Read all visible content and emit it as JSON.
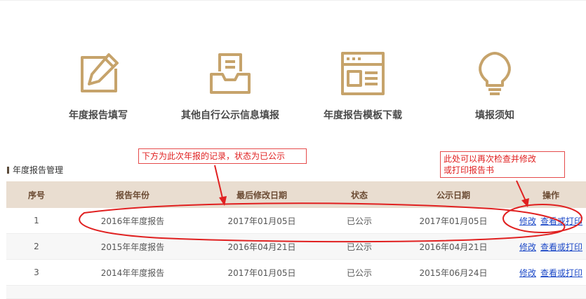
{
  "colors": {
    "gold": "#c6a36b",
    "annotation_red": "#e02020",
    "header_bg": "#e9ddd0"
  },
  "nav": [
    {
      "label": "年度报告填写",
      "icon": "edit-pencil-icon"
    },
    {
      "label": "其他自行公示信息填报",
      "icon": "inbox-tray-icon"
    },
    {
      "label": "年度报告模板下载",
      "icon": "template-window-icon"
    },
    {
      "label": "填报须知",
      "icon": "lightbulb-icon"
    }
  ],
  "section": {
    "title": "年度报告管理"
  },
  "table": {
    "headers": [
      "序号",
      "报告年份",
      "最后修改日期",
      "状态",
      "公示日期",
      "操作"
    ],
    "rows": [
      {
        "no": "1",
        "year": "2016年年度报告",
        "modified": "2017年01月05日",
        "status": "已公示",
        "published": "2017年01月05日",
        "edit": "修改",
        "view": "查看或打印"
      },
      {
        "no": "2",
        "year": "2015年年度报告",
        "modified": "2016年04月21日",
        "status": "已公示",
        "published": "2016年04月21日",
        "edit": "修改",
        "view": "查看或打印"
      },
      {
        "no": "3",
        "year": "2014年年度报告",
        "modified": "2017年01月05日",
        "status": "已公示",
        "published": "2015年06月24日",
        "edit": "修改",
        "view": "查看或打印"
      }
    ]
  },
  "annotations": {
    "note1": "下方为此次年报的记录，状态为已公示",
    "note2_line1": "此处可以再次检查并修改",
    "note2_line2": "或打印报告书"
  }
}
